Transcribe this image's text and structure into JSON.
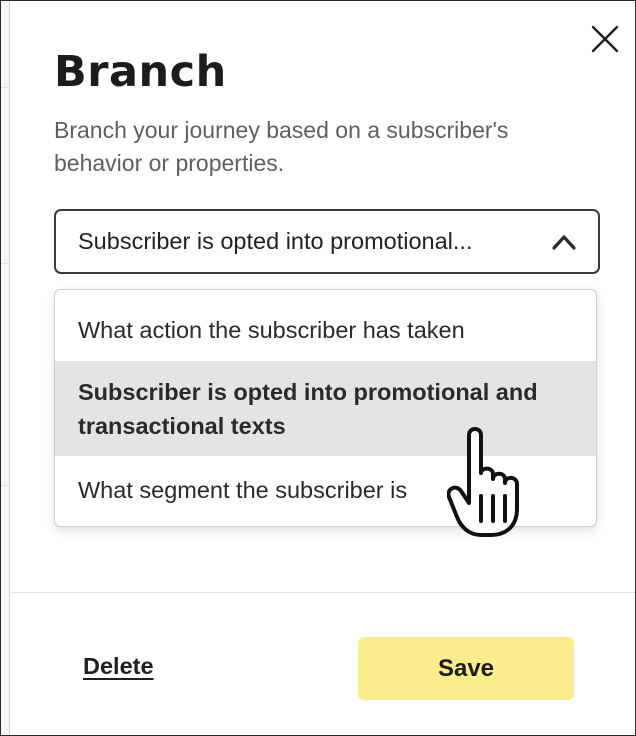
{
  "panel": {
    "title": "Branch",
    "description": "Branch your journey based on a subscriber's behavior or properties."
  },
  "select": {
    "value": "Subscriber is opted into promotional...",
    "state": "expanded",
    "options": [
      {
        "label": "What action the subscriber has taken"
      },
      {
        "label": "Subscriber is opted into promotional and transactional texts",
        "highlighted": true
      },
      {
        "label": "What segment the subscriber is"
      }
    ]
  },
  "footer": {
    "delete_label": "Delete",
    "save_label": "Save"
  },
  "colors": {
    "save_button": "#fbec8e",
    "highlighted_option": "#e3e4e4",
    "select_border": "#3a3a3a",
    "description_text": "#5f5f5f"
  },
  "icons": {
    "close": "close-icon",
    "chevron": "chevron-up-icon",
    "cursor": "hand-pointer-cursor-icon"
  }
}
